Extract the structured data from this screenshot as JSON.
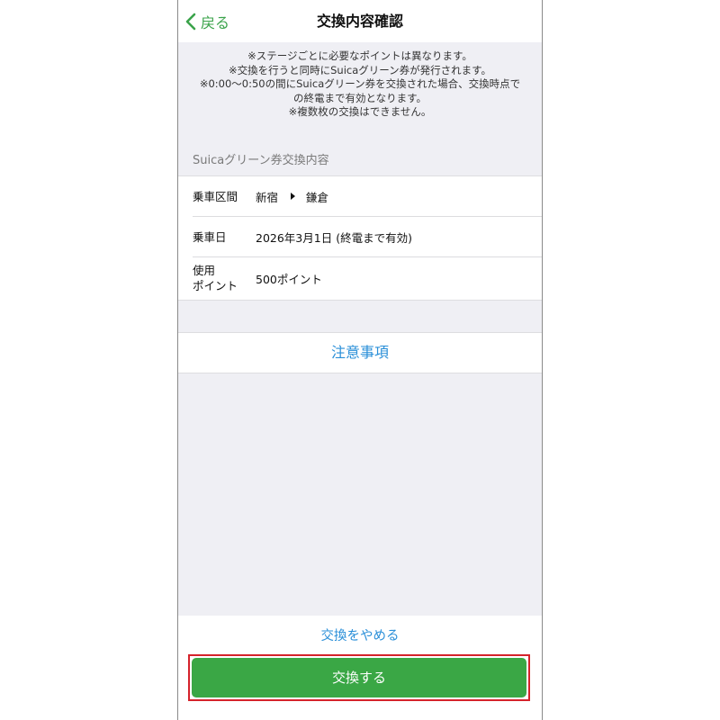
{
  "nav": {
    "back_label": "戻る",
    "title": "交換内容確認"
  },
  "notes": [
    "※ステージごとに必要なポイントは異なります。",
    "※交換を行うと同時にSuicaグリーン券が発行されます。",
    "※0:00～0:50の間にSuicaグリーン券を交換された場合、交換時点で",
    "の終電まで有効となります。",
    "※複数枚の交換はできません。"
  ],
  "section_header": "Suicaグリーン券交換内容",
  "details": {
    "route_label": "乗車区間",
    "from": "新宿",
    "to": "鎌倉",
    "date_label": "乗車日",
    "date_value": "2026年3月1日 (終電まで有効)",
    "points_label_line1": "使用",
    "points_label_line2": "ポイント",
    "points_value": "500ポイント"
  },
  "notice_label": "注意事項",
  "cancel_label": "交換をやめる",
  "exchange_label": "交換する",
  "colors": {
    "accent_green": "#3aa745",
    "link_blue": "#2a8fd8",
    "highlight_red": "#d5232b"
  }
}
